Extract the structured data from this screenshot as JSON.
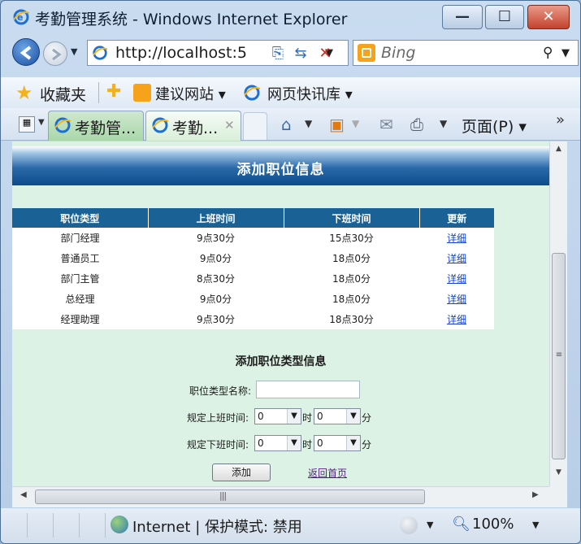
{
  "window": {
    "title": "考勤管理系统 - Windows Internet Explorer",
    "min_glyph": "—",
    "max_glyph": "☐",
    "close_glyph": "✕"
  },
  "addressbar": {
    "url": "http://localhost:5",
    "search_placeholder": "Bing"
  },
  "favorites": {
    "label": "收藏夹",
    "suggested_sites": "建议网站 ▾",
    "web_slice": "网页快讯库 ▾"
  },
  "tabs": [
    {
      "label": "考勤管..."
    },
    {
      "label": "考勤..."
    }
  ],
  "commandbar": {
    "page_menu": "页面(P) ▾"
  },
  "page": {
    "banner_title": "添加职位信息",
    "table": {
      "headers": [
        "职位类型",
        "上班时间",
        "下班时间",
        "更新"
      ],
      "rows": [
        {
          "type": "部门经理",
          "start": "9点30分",
          "end": "15点30分",
          "action": "详细"
        },
        {
          "type": "普通员工",
          "start": "9点0分",
          "end": "18点0分",
          "action": "详细"
        },
        {
          "type": "部门主管",
          "start": "8点30分",
          "end": "18点0分",
          "action": "详细"
        },
        {
          "type": "总经理",
          "start": "9点0分",
          "end": "18点0分",
          "action": "详细"
        },
        {
          "type": "经理助理",
          "start": "9点30分",
          "end": "18点30分",
          "action": "详细"
        }
      ]
    },
    "form": {
      "title": "添加职位类型信息",
      "name_label": "职位类型名称:",
      "name_value": "",
      "start_label": "规定上班时间:",
      "end_label": "规定下班时间:",
      "start_hour": "0",
      "start_minute": "0",
      "end_hour": "0",
      "end_minute": "0",
      "hour_unit": "时",
      "minute_unit": "分",
      "add_button": "添加",
      "back_link": "返回首页"
    }
  },
  "statusbar": {
    "zone": "Internet | 保护模式: 禁用",
    "zoom": "100%"
  },
  "colors": {
    "table_header": "#1a6196",
    "page_background": "#dcf2e4",
    "link": "#1244cc"
  }
}
